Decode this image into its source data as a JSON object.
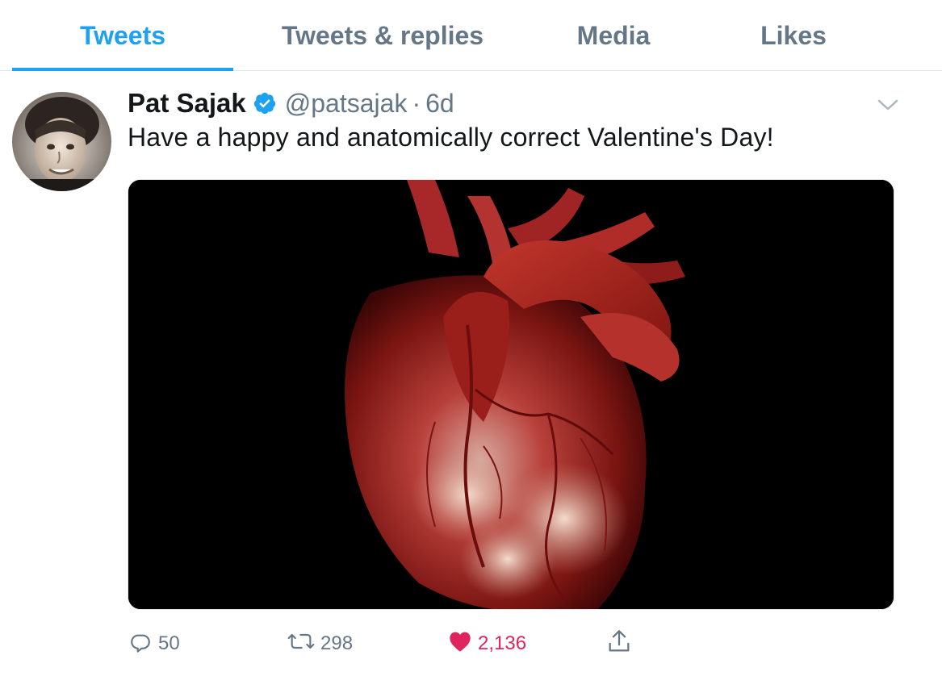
{
  "tabs": [
    {
      "label": "Tweets",
      "active": true
    },
    {
      "label": "Tweets & replies",
      "active": false
    },
    {
      "label": "Media",
      "active": false
    },
    {
      "label": "Likes",
      "active": false
    }
  ],
  "tweet": {
    "author_name": "Pat Sajak",
    "handle": "@patsajak",
    "separator": "·",
    "time": "6d",
    "verified": true,
    "text": "Have a happy and anatomically correct Valentine's Day!",
    "media_description_icon": "photo",
    "actions": {
      "reply": {
        "icon": "reply-icon",
        "count": "50"
      },
      "retweet": {
        "icon": "retweet-icon",
        "count": "298"
      },
      "like": {
        "icon": "heart-icon",
        "count": "2,136",
        "liked": true
      },
      "share": {
        "icon": "share-icon"
      }
    }
  },
  "colors": {
    "accent": "#1da1f2",
    "muted": "#657786",
    "like": "#e0245e",
    "divider": "#e1e8ed"
  }
}
